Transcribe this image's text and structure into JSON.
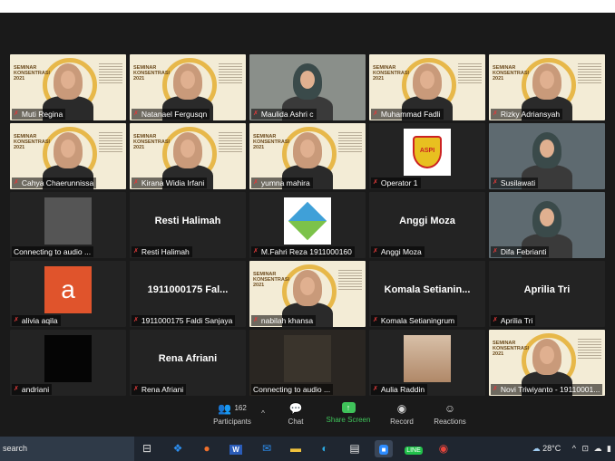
{
  "participants": [
    {
      "name": "Muti Regina",
      "type": "poster-cam"
    },
    {
      "name": "Natanael Fergusqn",
      "type": "poster-cam"
    },
    {
      "name": "Maulida Ashri c",
      "type": "cam"
    },
    {
      "name": "Muhammad Fadli",
      "type": "poster-cam"
    },
    {
      "name": "Rizky Adriansyah",
      "type": "poster-cam"
    },
    {
      "name": "Cahya Chaerunnissa",
      "type": "poster-cam"
    },
    {
      "name": "Kirana Widia Irfani",
      "type": "poster-cam"
    },
    {
      "name": "yumna mahira",
      "type": "poster-cam"
    },
    {
      "name": "Operator 1",
      "type": "logo"
    },
    {
      "name": "Susilawati",
      "type": "cam"
    },
    {
      "name": "Connecting to audio ...",
      "type": "gray-avatar"
    },
    {
      "name": "Resti Halimah",
      "type": "name-only",
      "center": "Resti Halimah"
    },
    {
      "name": "M.Fahri Reza 1911000160",
      "type": "cube-avatar"
    },
    {
      "name": "Anggi Moza",
      "type": "name-only",
      "center": "Anggi Moza"
    },
    {
      "name": "Difa Febrianti",
      "type": "cam"
    },
    {
      "name": "alivia aqila",
      "type": "letter-avatar",
      "letter": "a"
    },
    {
      "name": "1911000175 Faldi Sanjaya",
      "type": "name-only",
      "center": "1911000175 Fal..."
    },
    {
      "name": "nabilah khansa",
      "type": "poster-cam"
    },
    {
      "name": "Komala Setianingrum",
      "type": "name-only",
      "center": "Komala  Setianin..."
    },
    {
      "name": "Aprilia Tri",
      "type": "name-only",
      "center": "Aprilia Tri"
    },
    {
      "name": "andriani",
      "type": "black-avatar"
    },
    {
      "name": "Rena Afriani",
      "type": "name-only",
      "center": "Rena Afriani"
    },
    {
      "name": "Connecting to audio ...",
      "type": "dark-cam"
    },
    {
      "name": "Aulia Raddin",
      "type": "photo-avatar"
    },
    {
      "name": "Novi Triwiyanto - 19110001...",
      "type": "poster-cam"
    }
  ],
  "poster": {
    "title_line1": "SEMINAR",
    "title_line2": "KONSENTRASI",
    "title_line3": "2021"
  },
  "operator_logo_text": "ASPI",
  "toolbar": {
    "participants_count": "162",
    "participants_label": "Participants",
    "chat_label": "Chat",
    "share_label": "Share Screen",
    "record_label": "Record",
    "reactions_label": "Reactions"
  },
  "taskbar": {
    "search_placeholder": "search",
    "temperature": "28°C"
  },
  "colors": {
    "zoom_bg": "#1a1a1a",
    "share_green": "#3fc35a",
    "mic_muted": "#e03a3a",
    "poster_ring": "#e7b84a"
  }
}
